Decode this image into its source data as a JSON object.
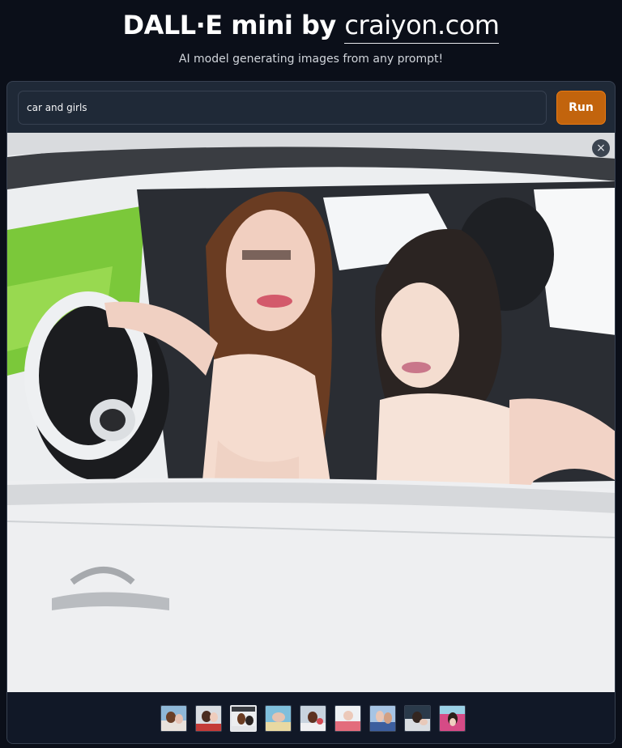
{
  "header": {
    "title_prefix": "DALL·E mini by ",
    "title_link": "craiyon.com",
    "subtitle": "AI model generating images from any prompt!"
  },
  "prompt": {
    "value": "car and girls"
  },
  "run_button": {
    "label": "Run"
  },
  "gallery": {
    "close_icon": "×",
    "selected_thumbnail": 3,
    "thumbnail_count": 9
  },
  "colors": {
    "background": "#0b0f19",
    "panel": "#1f2937",
    "accent": "#c2640d"
  }
}
